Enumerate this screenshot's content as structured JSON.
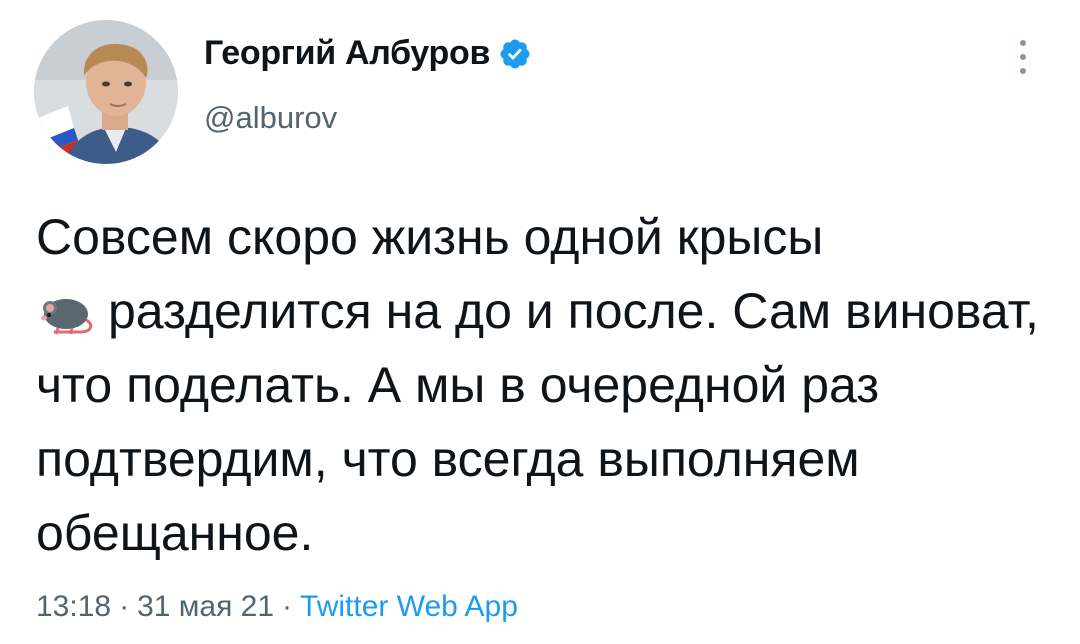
{
  "author": {
    "display_name": "Георгий Албуров",
    "handle": "@alburov",
    "verified": true,
    "avatar_icon": "profile-photo"
  },
  "tweet": {
    "text_before_emoji": "Совсем скоро жизнь одной крысы",
    "emoji": "rat-emoji",
    "text_after_emoji": "разделится на до и после. Сам виноват, что поделать. А мы в очередной раз подтвердим, что всегда выполняем обещанное."
  },
  "meta": {
    "time": "13:18",
    "separator": "·",
    "date": "31 мая 21",
    "source": "Twitter Web App"
  },
  "colors": {
    "text": "#0f1419",
    "secondary": "#536471",
    "link": "#1d9bf0",
    "verified": "#1d9bf0"
  }
}
